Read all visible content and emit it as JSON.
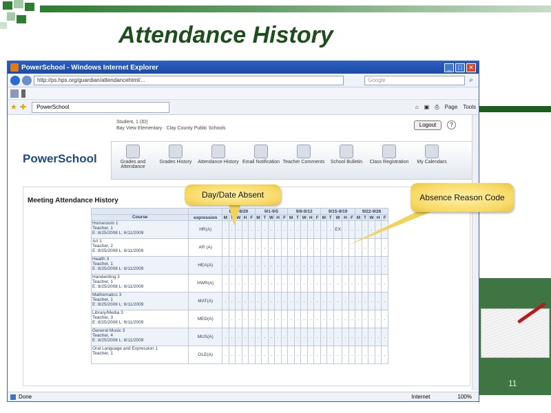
{
  "slide": {
    "title": "Attendance History",
    "page_number": "11"
  },
  "browser": {
    "window_title": "PowerSchool - Windows Internet Explorer",
    "url": "http://ps.hps.org/guardian/attendancehtml/...",
    "search_placeholder": "Google",
    "tab_label": "PowerSchool",
    "tools": [
      "Page",
      "Tools"
    ],
    "status": "Done",
    "zone": "Internet",
    "zoom": "100%"
  },
  "powerschool": {
    "logo": "PowerSchool",
    "student_line1": "Student, 1 (ID)",
    "student_line2": "Bay View Elementary · Clay County Public Schools",
    "logout": "Logout",
    "help": "?",
    "nav": [
      {
        "label": "Grades and Attendance"
      },
      {
        "label": "Grades History"
      },
      {
        "label": "Attendance History"
      },
      {
        "label": "Email Notification"
      },
      {
        "label": "Teacher Comments"
      },
      {
        "label": "School Bulletin"
      },
      {
        "label": "Class Registration"
      },
      {
        "label": "My Calendars"
      }
    ]
  },
  "attendance": {
    "heading": "Meeting Attendance History",
    "col_course": "Course",
    "col_expression": "expression",
    "weeks": [
      "8/25-8/29",
      "9/1-9/5",
      "9/8-9/12",
      "9/15-9/19",
      "9/22-9/26"
    ],
    "days": [
      "M",
      "T",
      "W",
      "H",
      "F"
    ],
    "rows": [
      {
        "course": "Homeroom 1",
        "teacher": "Teacher, 1",
        "dates": "E: 8/25/2008  L: 6/11/2009",
        "expr": "HR(A)",
        "mark": "EX"
      },
      {
        "course": "Art 1",
        "teacher": "Teacher, 2",
        "dates": "E: 8/25/2008  L: 6/11/2009",
        "expr": "AR (A)",
        "mark": ""
      },
      {
        "course": "Health 3",
        "teacher": "Teacher, 1",
        "dates": "E: 8/25/2008  L: 6/11/2009",
        "expr": "HEA(A)",
        "mark": ""
      },
      {
        "course": "Handwriting 3",
        "teacher": "Teacher, 1",
        "dates": "E: 8/25/2008  L: 6/11/2009",
        "expr": "HWR(A)",
        "mark": ""
      },
      {
        "course": "Mathematics 3",
        "teacher": "Teacher, 1",
        "dates": "E: 8/25/2008  L: 6/11/2009",
        "expr": "MAT(A)",
        "mark": ""
      },
      {
        "course": "Library/Media 3",
        "teacher": "Teacher, 3",
        "dates": "E: 8/25/2008  L: 6/11/2009",
        "expr": "MED(A)",
        "mark": ""
      },
      {
        "course": "General Music 3",
        "teacher": "Teacher, 4",
        "dates": "E: 8/25/2008  L: 6/11/2009",
        "expr": "MUS(A)",
        "mark": ""
      },
      {
        "course": "Oral Language and Expression 1",
        "teacher": "Teacher, 1",
        "dates": "",
        "expr": "OLE(A)",
        "mark": ""
      }
    ]
  },
  "callouts": {
    "day_date": "Day/Date Absent",
    "reason": "Absence Reason Code"
  },
  "colors": {
    "title": "#1e4d1e",
    "accent_green": "#2e7d32",
    "callout": "#f7d966",
    "ie_blue": "#1d4aa6"
  }
}
